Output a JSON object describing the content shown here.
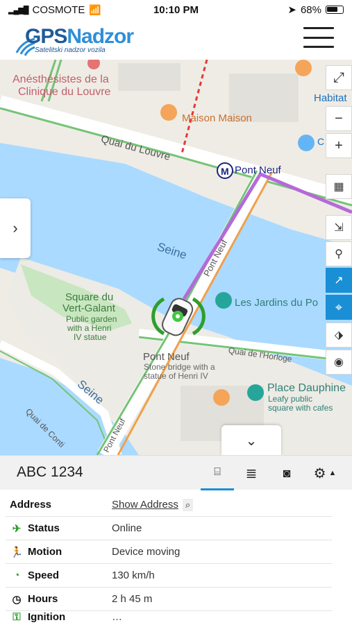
{
  "status_bar": {
    "carrier": "COSMOTE",
    "time": "10:10 PM",
    "battery": "68%"
  },
  "header": {
    "logo_main_a": "GPS",
    "logo_main_b": "Nadzor",
    "logo_tagline": "Satelitski nadzor vozila",
    "menu_icon": "hamburger-icon"
  },
  "map": {
    "labels": {
      "anesthesistes": "Anésthésistes de la",
      "clinique": "Clinique du Louvre",
      "maison": "Maison Maison",
      "habitat": "Habitat",
      "c_label": "C",
      "quai_louvre": "Quai du Louvre",
      "pont_neuf_metro": "Pont Neuf",
      "seine_1": "Seine",
      "pont_neuf_road": "Pont Neuf",
      "square": "Square du",
      "vert_galant": "Vert-Galant",
      "public_garden": "Public garden",
      "with_henri": "with a Henri",
      "iv_statue": "IV statue",
      "jardins": "Les Jardins du Po",
      "quai_horloge": "Quai de l'Horloge",
      "pont_neuf_poi": "Pont Neuf",
      "stone_bridge": "Stone bridge with a",
      "statue_henri": "statue of Henri IV",
      "place_dauphine": "Place Dauphine",
      "leafy": "Leafy public",
      "square_cafes": "square with cafes",
      "seine_2": "Seine",
      "quai_conti": "Quai de Conti",
      "pont_neuf_road_2": "Pont Neuf"
    }
  },
  "vehicle": {
    "name": "ABC 1234",
    "rows": [
      {
        "key": "Address",
        "value": "Show Address",
        "icon": ""
      },
      {
        "key": "Status",
        "value": "Online",
        "icon": "satellite-icon"
      },
      {
        "key": "Motion",
        "value": "Device moving",
        "icon": "running-icon"
      },
      {
        "key": "Speed",
        "value": "130 km/h",
        "icon": "speedometer-icon"
      },
      {
        "key": "Hours",
        "value": "2 h 45 m",
        "icon": "clock-icon"
      },
      {
        "key": "Ignition",
        "value": "…",
        "icon": "ignition-icon"
      }
    ]
  },
  "colors": {
    "accent": "#1a8fd6",
    "water": "#aadaff",
    "route": "#b56ad8"
  }
}
